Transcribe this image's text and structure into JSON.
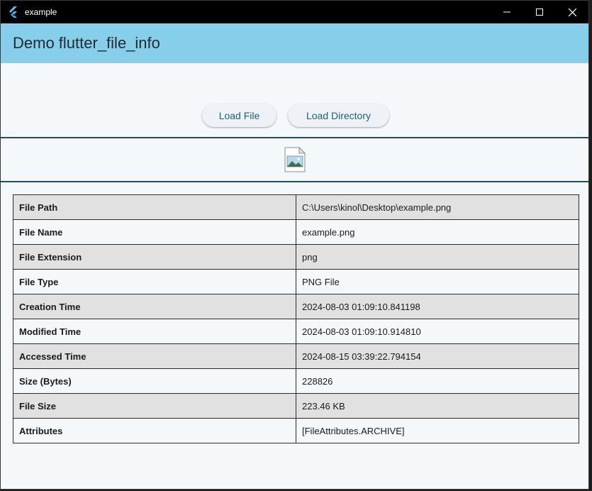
{
  "window": {
    "title": "example",
    "controls": {
      "minimize": "—",
      "maximize": "☐",
      "close": "✕"
    }
  },
  "appbar": {
    "title": "Demo flutter_file_info"
  },
  "actions": {
    "load_file": "Load File",
    "load_directory": "Load Directory"
  },
  "file_icon": "image-file-icon",
  "info_table": [
    {
      "key": "File Path",
      "value": "C:\\Users\\kinol\\Desktop\\example.png"
    },
    {
      "key": "File Name",
      "value": "example.png"
    },
    {
      "key": "File Extension",
      "value": "png"
    },
    {
      "key": "File Type",
      "value": "PNG File"
    },
    {
      "key": "Creation Time",
      "value": "2024-08-03 01:09:10.841198"
    },
    {
      "key": "Modified Time",
      "value": "2024-08-03 01:09:10.914810"
    },
    {
      "key": "Accessed Time",
      "value": "2024-08-15 03:39:22.794154"
    },
    {
      "key": "Size (Bytes)",
      "value": "228826"
    },
    {
      "key": "File Size",
      "value": "223.46 KB"
    },
    {
      "key": "Attributes",
      "value": "[FileAttributes.ARCHIVE]"
    }
  ],
  "colors": {
    "appbar": "#87ceeb",
    "accent": "#1d5f7a",
    "row_shade": "#e1e1e1",
    "background": "#f5f8fb"
  }
}
